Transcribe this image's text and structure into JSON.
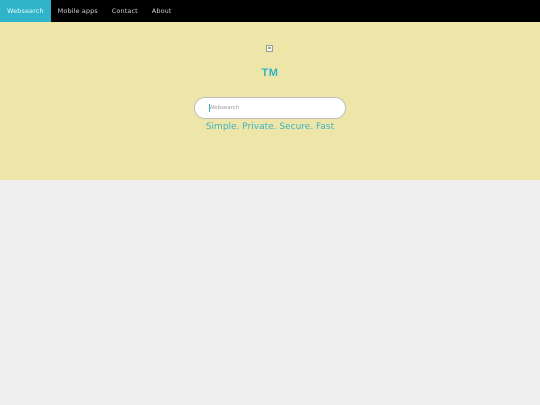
{
  "nav": {
    "items": [
      {
        "label": "Websearch",
        "active": true
      },
      {
        "label": "Mobile apps",
        "active": false
      },
      {
        "label": "Contact",
        "active": false
      },
      {
        "label": "About",
        "active": false
      }
    ]
  },
  "hero": {
    "brand": "TM",
    "search_placeholder": "Websearch",
    "tagline": "Simple. Private. Secure. Fast"
  },
  "colors": {
    "accent": "#2fb4c9",
    "hero_bg": "#eee6a8",
    "nav_bg": "#000000",
    "page_bg": "#efefef"
  },
  "icons": {
    "logo": "broken-image-icon"
  }
}
